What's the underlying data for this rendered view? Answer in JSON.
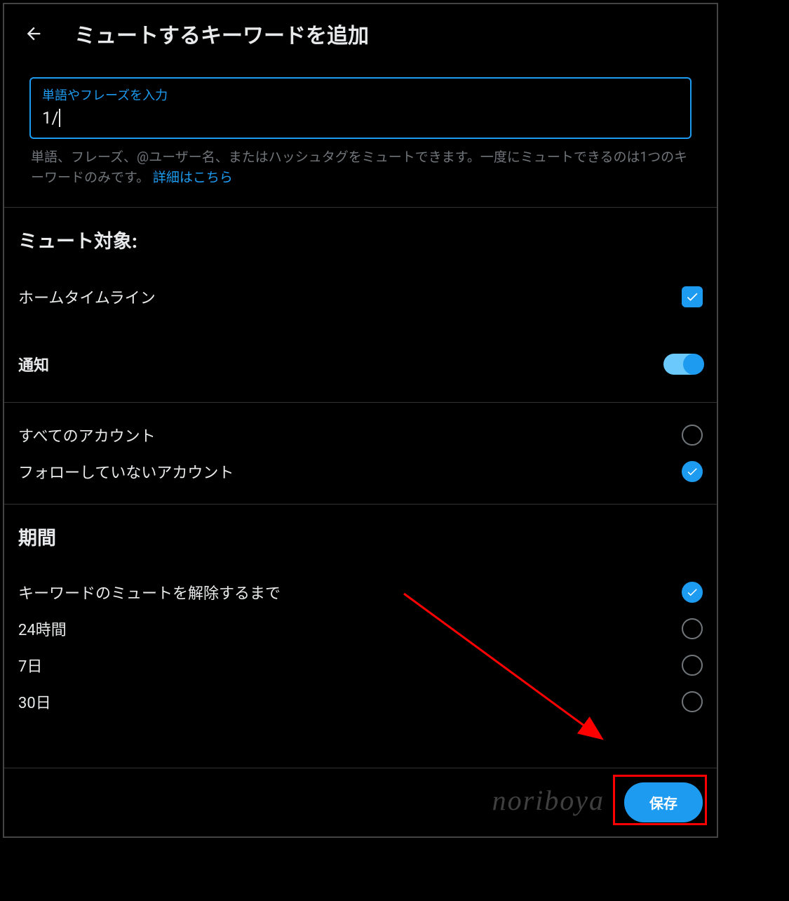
{
  "header": {
    "title": "ミュートするキーワードを追加"
  },
  "input": {
    "label": "単語やフレーズを入力",
    "value": "1/"
  },
  "help": {
    "text": "単語、フレーズ、@ユーザー名、またはハッシュタグをミュートできます。一度にミュートできるのは1つのキーワードのみです。",
    "link": "詳細はこちら"
  },
  "mute_target": {
    "title": "ミュート対象:",
    "home_timeline": {
      "label": "ホームタイムライン",
      "checked": true
    },
    "notifications": {
      "label": "通知",
      "on": true
    }
  },
  "accounts": {
    "all": {
      "label": "すべてのアカウント",
      "selected": false
    },
    "not_following": {
      "label": "フォローしていないアカウント",
      "selected": true
    }
  },
  "duration": {
    "title": "期間",
    "options": [
      {
        "label": "キーワードのミュートを解除するまで",
        "selected": true
      },
      {
        "label": "24時間",
        "selected": false
      },
      {
        "label": "7日",
        "selected": false
      },
      {
        "label": "30日",
        "selected": false
      }
    ]
  },
  "footer": {
    "save_label": "保存"
  },
  "watermark": "noriboya"
}
